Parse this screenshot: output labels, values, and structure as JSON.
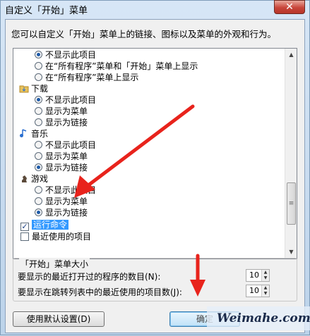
{
  "window": {
    "title": "自定义「开始」菜单",
    "close": "✕"
  },
  "description": "您可以自定义「开始」菜单上的链接、图标以及菜单的外观和行为。",
  "tree": {
    "opt1": "不显示此项目",
    "opt2": "在“所有程序”菜单和「开始」菜单上显示",
    "opt3": "在“所有程序”菜单上显示",
    "downloads": {
      "label": "下载",
      "o1": "不显示此项目",
      "o2": "显示为菜单",
      "o3": "显示为链接"
    },
    "music": {
      "label": "音乐",
      "o1": "不显示此项目",
      "o2": "显示为菜单",
      "o3": "显示为链接"
    },
    "games": {
      "label": "游戏",
      "o1": "不显示此项目",
      "o2": "显示为菜单",
      "o3": "显示为链接"
    },
    "run": "运行命令",
    "recent": "最近使用的项目"
  },
  "start_size": {
    "title": "「开始」菜单大小",
    "row1": {
      "label": "要显示的最近打开过的程序的数目(N):",
      "value": "10"
    },
    "row2": {
      "label": "要显示在跳转列表中的最近使用的项目数(J):",
      "value": "10"
    }
  },
  "buttons": {
    "defaults": "使用默认设置(D)",
    "ok": "确定"
  },
  "watermark": "Weimahe.com",
  "colors": {
    "selection": "#3399ff",
    "arrow": "#e8231c"
  }
}
